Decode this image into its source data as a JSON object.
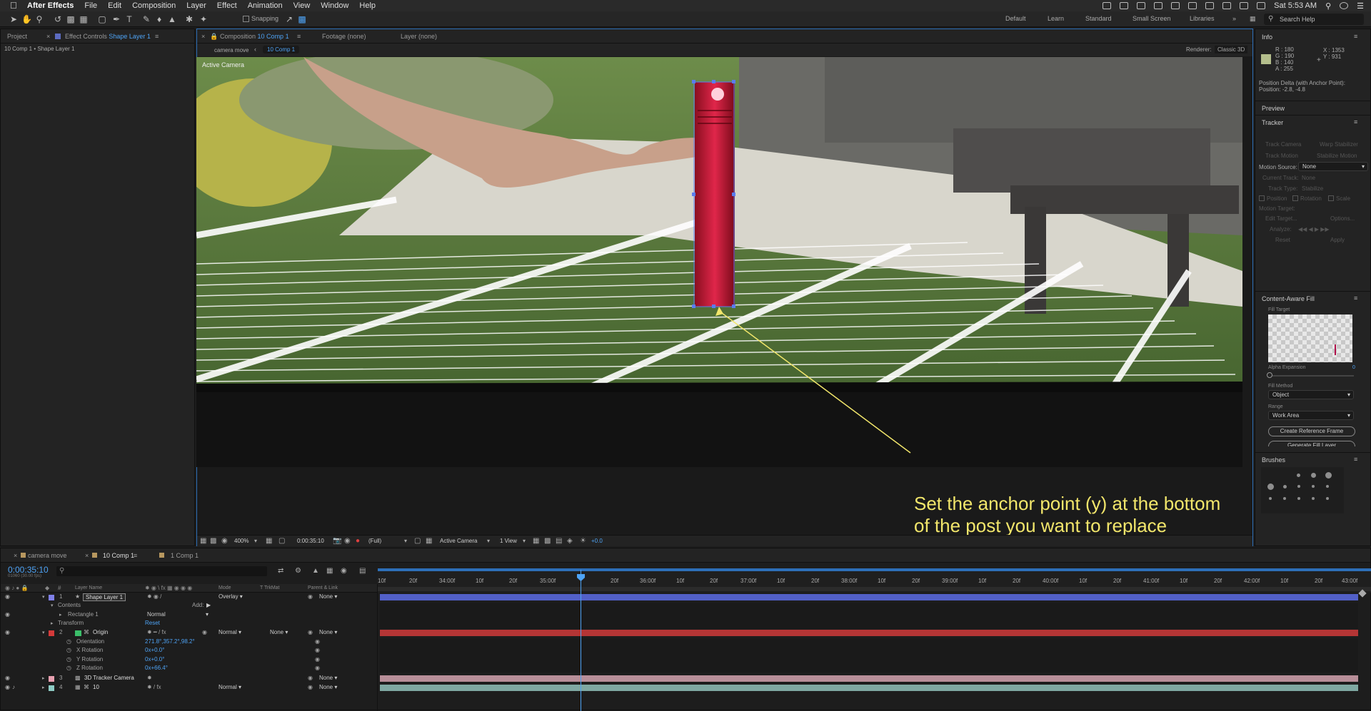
{
  "menubar": {
    "app": "After Effects",
    "items": [
      "File",
      "Edit",
      "Composition",
      "Layer",
      "Effect",
      "Animation",
      "View",
      "Window",
      "Help"
    ],
    "clock": "Sat 5:53 AM"
  },
  "toolbar": {
    "snapping": "Snapping",
    "workspaces": [
      "Default",
      "Learn",
      "Standard",
      "Small Screen",
      "Libraries"
    ],
    "search": "Search Help"
  },
  "project_panel": {
    "tab_project": "Project",
    "tab_effect_controls": "Effect Controls",
    "tab_effect_target": "Shape Layer 1",
    "breadcrumb": "10 Comp 1 • Shape Layer 1"
  },
  "comp_panel": {
    "tab_composition": "Composition",
    "tab_comp_name": "10 Comp 1",
    "tab_footage": "Footage (none)",
    "tab_layer": "Layer (none)",
    "crumb_1": "camera move",
    "crumb_2": "10 Comp 1",
    "renderer_label": "Renderer:",
    "renderer_value": "Classic 3D",
    "view_label": "Active Camera",
    "annotation_line1": "Set the anchor point (y) at the bottom",
    "annotation_line2": "of the post you want to replace",
    "footer": {
      "zoom": "400%",
      "timecode": "0:00:35:10",
      "resolution": "(Full)",
      "camera": "Active Camera",
      "views": "1 View",
      "exposure": "+0.0"
    }
  },
  "info_panel": {
    "title": "Info",
    "r": "R : 180",
    "g": "G : 190",
    "b": "B : 140",
    "a": "A : 255",
    "x": "X : 1353",
    "y": "Y : 931",
    "delta_label": "Position Delta (with Anchor Point):",
    "delta_value": "Position: -2.8, -4.8",
    "swatch_color": "#b4be8c"
  },
  "preview_panel": {
    "title": "Preview"
  },
  "tracker_panel": {
    "title": "Tracker",
    "track_camera": "Track Camera",
    "warp_stabilizer": "Warp Stabilizer",
    "track_motion": "Track Motion",
    "stabilize_motion": "Stabilize Motion",
    "motion_source_label": "Motion Source:",
    "motion_source_value": "None",
    "current_track_label": "Current Track:",
    "current_track_value": "None",
    "track_type_label": "Track Type:",
    "track_type_value": "Stabilize",
    "position": "Position",
    "rotation": "Rotation",
    "scale": "Scale",
    "motion_target": "Motion Target:",
    "edit_target": "Edit Target...",
    "options": "Options...",
    "analyze": "Analyze:",
    "reset": "Reset",
    "apply": "Apply"
  },
  "caf_panel": {
    "title": "Content-Aware Fill",
    "fill_target": "Fill Target",
    "alpha_expansion": "Alpha Expansion",
    "alpha_value": "0",
    "fill_method": "Fill Method",
    "fill_method_value": "Object",
    "range": "Range",
    "range_value": "Work Area",
    "create_ref": "Create Reference Frame",
    "generate": "Generate Fill Layer"
  },
  "brushes_panel": {
    "title": "Brushes"
  },
  "timeline": {
    "tabs": [
      "camera move",
      "10 Comp 1",
      "1 Comp 1"
    ],
    "timecode": "0:00:35:10",
    "fps": "01060 (30.00 fps)",
    "headers": {
      "layer_name": "Layer Name",
      "mode": "Mode",
      "trk": "T  TrkMat",
      "parent": "Parent & Link"
    },
    "ruler": [
      "10f",
      "20f",
      "34:00f",
      "10f",
      "20f",
      "35:00f",
      "20f",
      "36:00f",
      "10f",
      "20f",
      "37:00f",
      "10f",
      "20f",
      "38:00f",
      "10f",
      "20f",
      "39:00f",
      "10f",
      "20f",
      "40:00f",
      "10f",
      "20f",
      "41:00f",
      "10f",
      "20f",
      "42:00f",
      "10f",
      "20f",
      "43:00f"
    ],
    "layers": [
      {
        "num": "1",
        "name": "Shape Layer 1",
        "mode": "Overlay",
        "parent": "None",
        "color": "#7f7fe8"
      },
      {
        "num": "2",
        "name": "Origin",
        "mode": "Normal",
        "trkmat": "None",
        "parent": "None",
        "color": "#d43a3a"
      },
      {
        "num": "3",
        "name": "3D Tracker Camera",
        "parent": "None",
        "color": "#e8a0b0"
      },
      {
        "num": "4",
        "name": "10",
        "mode": "Normal",
        "parent": "None",
        "color": "#8ecbc4"
      }
    ],
    "contents": "Contents",
    "add": "Add:",
    "rectangle": "Rectangle 1",
    "rectangle_mode": "Normal",
    "transform": "Transform",
    "reset": "Reset",
    "orientation_label": "Orientation",
    "orientation_value": "271.8°,357.2°,98.2°",
    "x_rot_label": "X Rotation",
    "x_rot_value": "0x+0.0°",
    "y_rot_label": "Y Rotation",
    "y_rot_value": "0x+0.0°",
    "z_rot_label": "Z Rotation",
    "z_rot_value": "0x+66.4°"
  }
}
